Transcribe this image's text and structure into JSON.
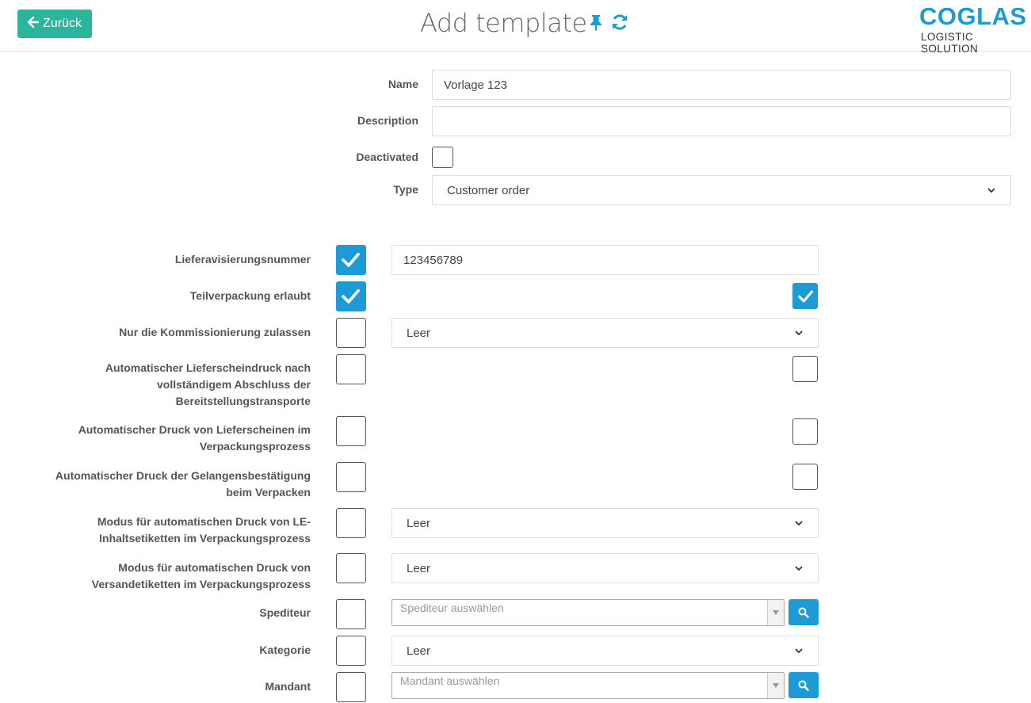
{
  "header": {
    "back_label": "Zurück",
    "title": "Add template",
    "logo_main": "COGLAS",
    "logo_sub": "LOGISTIC SOLUTION",
    "pin_icon": "pin-icon",
    "refresh_icon": "refresh-icon",
    "accent_color": "#1e9bd7",
    "back_color": "#2bb59a"
  },
  "form": {
    "name_label": "Name",
    "name_value": "Vorlage 123",
    "description_label": "Description",
    "description_value": "",
    "deactivated_label": "Deactivated",
    "deactivated_checked": false,
    "type_label": "Type",
    "type_value": "Customer order"
  },
  "options": [
    {
      "label": "Lieferavisierungsnummer",
      "checked": true,
      "value": "123456789"
    },
    {
      "label": "Teilverpackung erlaubt",
      "checked": true,
      "right_checked": true
    },
    {
      "label": "Nur die Kommissionierung zulassen",
      "checked": false,
      "select_value": "Leer"
    },
    {
      "label": "Automatischer Lieferscheindruck nach vollständigem Abschluss der Bereitstellungstransporte",
      "checked": false,
      "right_checked": false
    },
    {
      "label": "Automatischer Druck von Lieferscheinen im Verpackungsprozess",
      "checked": false,
      "right_checked": false
    },
    {
      "label": "Automatischer Druck der Gelangensbestätigung beim Verpacken",
      "checked": false,
      "right_checked": false
    },
    {
      "label": "Modus für automatischen Druck von LE-Inhaltsetiketten im Verpackungsprozess",
      "checked": false,
      "select_value": "Leer"
    },
    {
      "label": "Modus für automatischen Druck von Versandetiketten im Verpackungsprozess",
      "checked": false,
      "select_value": "Leer"
    },
    {
      "label": "Spediteur",
      "checked": false,
      "placeholder": "Spediteur auswählen"
    },
    {
      "label": "Kategorie",
      "checked": false,
      "select_value": "Leer"
    },
    {
      "label": "Mandant",
      "checked": false,
      "placeholder": "Mandant auswählen"
    }
  ]
}
